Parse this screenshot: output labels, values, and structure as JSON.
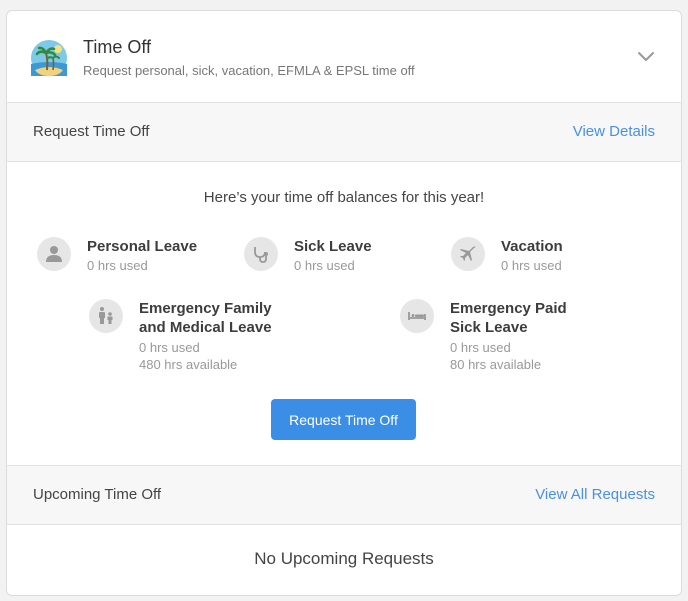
{
  "header": {
    "title": "Time Off",
    "subtitle": "Request personal, sick, vacation, EFMLA & EPSL time off",
    "logo_icon": "beach-palm-icon",
    "collapse_icon": "chevron-down-icon"
  },
  "request_section": {
    "title": "Request Time Off",
    "link": "View Details"
  },
  "balances": {
    "heading": "Here’s your time off balances for this year!",
    "items": [
      {
        "name": "Personal Leave",
        "used": "0 hrs used",
        "icon": "person-icon"
      },
      {
        "name": "Sick Leave",
        "used": "0 hrs used",
        "icon": "stethoscope-icon"
      },
      {
        "name": "Vacation",
        "used": "0 hrs used",
        "icon": "airplane-icon"
      },
      {
        "name_line1": "Emergency Family",
        "name_line2": "and Medical Leave",
        "used": "0 hrs used",
        "available": "480 hrs available",
        "icon": "family-icon"
      },
      {
        "name_line1": "Emergency Paid",
        "name_line2": "Sick Leave",
        "used": "0 hrs used",
        "available": "80 hrs available",
        "icon": "bed-icon"
      }
    ]
  },
  "request_button": "Request Time Off",
  "upcoming_section": {
    "title": "Upcoming Time Off",
    "link": "View All Requests",
    "empty_text": "No Upcoming Requests"
  },
  "colors": {
    "accent": "#3a8ee6",
    "link": "#4a90e2"
  }
}
